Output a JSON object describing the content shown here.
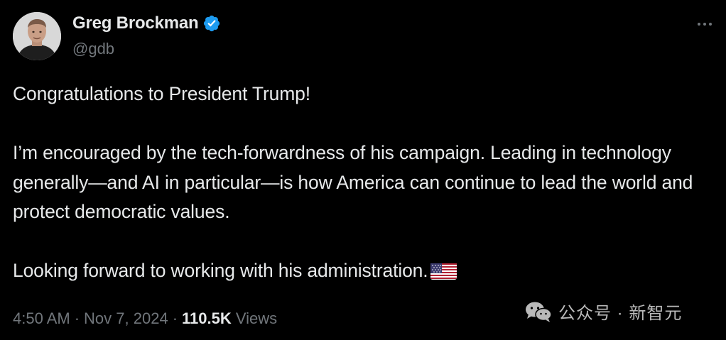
{
  "author": {
    "display_name": "Greg Brockman",
    "handle": "@gdb",
    "verified": true
  },
  "tweet": {
    "paragraphs": [
      "Congratulations to President Trump!",
      "I’m encouraged by the tech-forwardness of his campaign. Leading in technology generally—and AI in particular—is how America can continue to lead the world and protect democratic values.",
      "Looking forward to working with his administration."
    ],
    "emoji": "us-flag-icon"
  },
  "meta": {
    "time": "4:50 AM",
    "separator": "·",
    "date": "Nov 7, 2024",
    "views_count": "110.5K",
    "views_label": "Views"
  },
  "watermark": {
    "text": "公众号 · 新智元",
    "icon": "wechat-icon"
  },
  "colors": {
    "background": "#000000",
    "text_primary": "#e7e9ea",
    "text_secondary": "#71767b",
    "verified_badge": "#1d9bf0"
  }
}
